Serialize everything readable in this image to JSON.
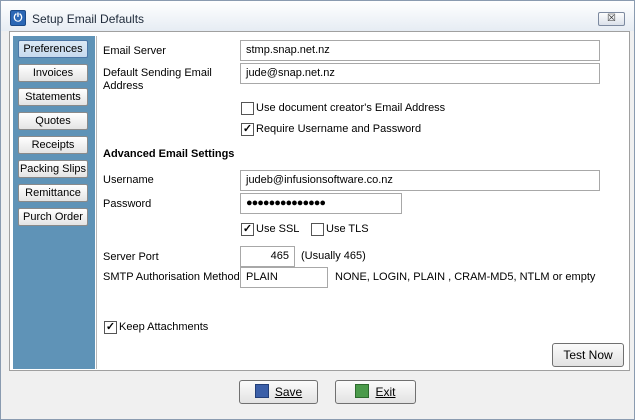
{
  "window": {
    "title": "Setup Email Defaults",
    "close_label": "☒"
  },
  "sidebar": {
    "items": [
      {
        "label": "Preferences"
      },
      {
        "label": "Invoices"
      },
      {
        "label": "Statements"
      },
      {
        "label": "Quotes"
      },
      {
        "label": "Receipts"
      },
      {
        "label": "Packing Slips"
      },
      {
        "label": "Remittance"
      },
      {
        "label": "Purch Order"
      }
    ]
  },
  "form": {
    "email_server_label": "Email Server",
    "email_server_value": "stmp.snap.net.nz",
    "sending_label": "Default Sending Email Address",
    "sending_value": "jude@snap.net.nz",
    "use_creator_label": "Use document creator's Email Address",
    "use_creator_checked": false,
    "require_auth_label": "Require Username and Password",
    "require_auth_checked": true,
    "advanced_heading": "Advanced Email Settings",
    "username_label": "Username",
    "username_value": "judeb@infusionsoftware.co.nz",
    "password_label": "Password",
    "password_value": "●●●●●●●●●●●●●●",
    "use_ssl_label": "Use SSL",
    "use_ssl_checked": true,
    "use_tls_label": "Use TLS",
    "use_tls_checked": false,
    "server_port_label": "Server Port",
    "server_port_value": "465",
    "server_port_hint": "(Usually 465)",
    "smtp_auth_label": "SMTP Authorisation Method",
    "smtp_auth_value": "PLAIN",
    "smtp_auth_hint": "NONE,  LOGIN,  PLAIN ,  CRAM-MD5,  NTLM or empty",
    "keep_attachments_label": "Keep Attachments",
    "keep_attachments_checked": true,
    "test_now_label": "Test Now"
  },
  "footer": {
    "save_label": "Save",
    "exit_label": "Exit"
  }
}
